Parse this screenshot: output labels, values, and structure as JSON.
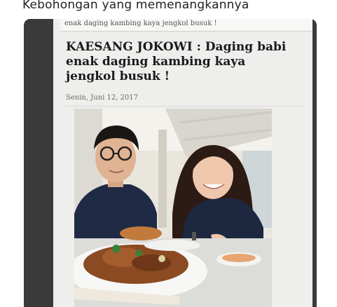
{
  "tweet": {
    "caption": "Kebohongan yang memenangkannya"
  },
  "article": {
    "top_snippet": "enak daging kambing kaya jengkol busuk !",
    "headline": "KAESANG JOKOWI : Daging babi enak daging kambing kaya jengkol busuk !",
    "date": "Senin, Juni 12, 2017"
  }
}
